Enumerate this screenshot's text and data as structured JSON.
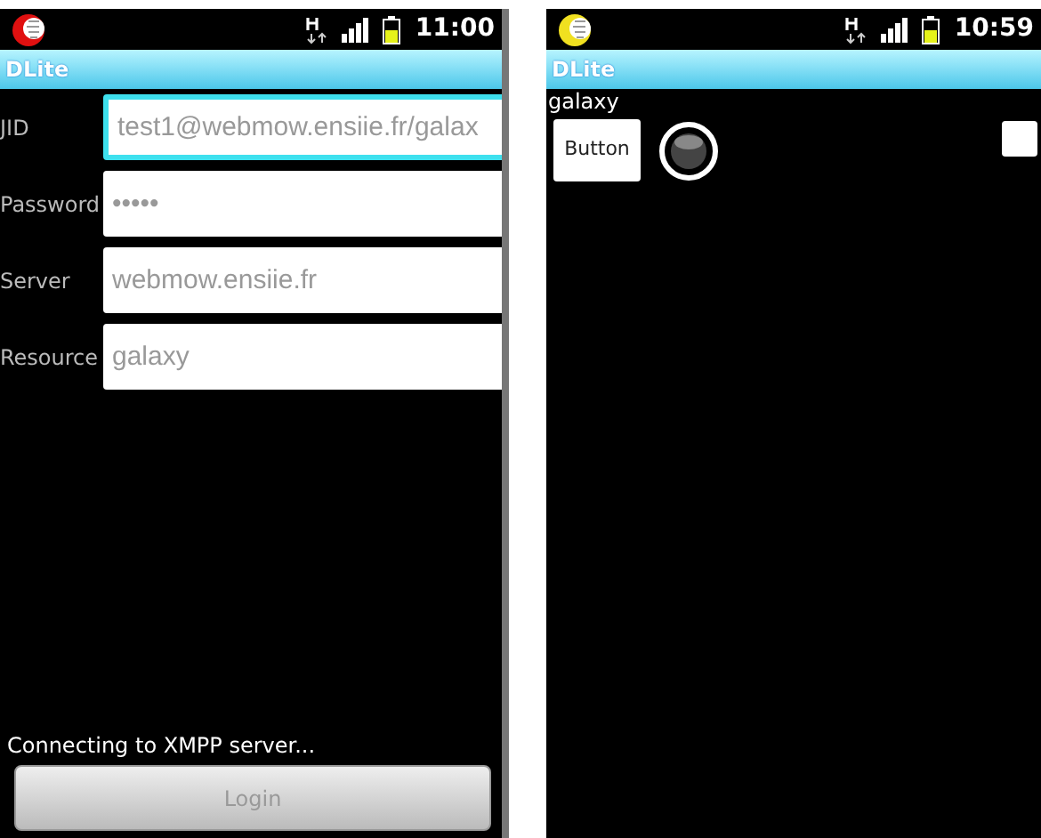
{
  "screens": [
    {
      "kind": "login",
      "status_bar": {
        "time": "11:00",
        "app_icon": {
          "color": "#e01010"
        }
      },
      "title": "DLite",
      "fields": [
        {
          "label": "JID",
          "value": "test1@webmow.ensiie.fr/galax",
          "focused": true,
          "disabled": true
        },
        {
          "label": "Password",
          "value": "•••••",
          "focused": false,
          "disabled": true
        },
        {
          "label": "Server",
          "value": "webmow.ensiie.fr",
          "focused": false,
          "disabled": true
        },
        {
          "label": "Resource",
          "value": "galaxy",
          "focused": false,
          "disabled": true
        }
      ],
      "status_text": "Connecting to XMPP server...",
      "login_button": {
        "label": "Login",
        "disabled": true
      }
    },
    {
      "kind": "main",
      "status_bar": {
        "time": "10:59",
        "app_icon": {
          "color": "#f0e020"
        }
      },
      "title": "DLite",
      "heading": "galaxy",
      "button": "Button",
      "toggle": {
        "checked": false
      }
    }
  ]
}
